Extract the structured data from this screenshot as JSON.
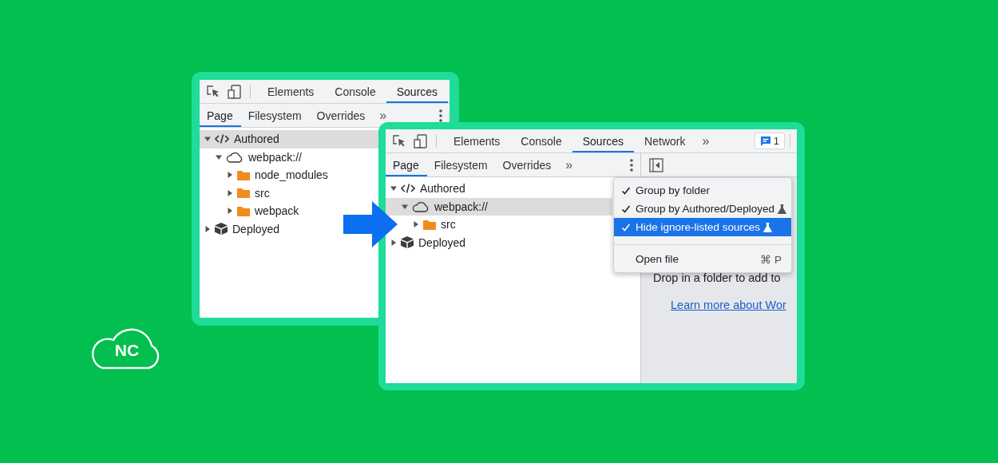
{
  "windows": [
    {
      "tabs": [
        {
          "label": "Elements",
          "selected": false
        },
        {
          "label": "Console",
          "selected": false
        },
        {
          "label": "Sources",
          "selected": true
        }
      ],
      "subtabs": [
        {
          "label": "Page",
          "selected": true
        },
        {
          "label": "Filesystem",
          "selected": false
        },
        {
          "label": "Overrides",
          "selected": false
        }
      ],
      "subtabs_more": "»",
      "tree": [
        {
          "label": "Authored",
          "kind": "code",
          "expanded": true,
          "selected": true,
          "children": [
            {
              "label": "webpack://",
              "kind": "cloud",
              "expanded": true,
              "selected": false,
              "children": [
                {
                  "label": "node_modules",
                  "kind": "folder",
                  "expanded": false,
                  "selected": false
                },
                {
                  "label": "src",
                  "kind": "folder",
                  "expanded": false,
                  "selected": false
                },
                {
                  "label": "webpack",
                  "kind": "folder",
                  "expanded": false,
                  "selected": false
                }
              ]
            }
          ]
        },
        {
          "label": "Deployed",
          "kind": "box",
          "expanded": false,
          "selected": false
        }
      ]
    },
    {
      "tabs": [
        {
          "label": "Elements",
          "selected": false
        },
        {
          "label": "Console",
          "selected": false
        },
        {
          "label": "Sources",
          "selected": true
        },
        {
          "label": "Network",
          "selected": false
        }
      ],
      "tabs_more": "»",
      "issues_badge": "1",
      "subtabs": [
        {
          "label": "Page",
          "selected": true
        },
        {
          "label": "Filesystem",
          "selected": false
        },
        {
          "label": "Overrides",
          "selected": false
        }
      ],
      "subtabs_more": "»",
      "tree": [
        {
          "label": "Authored",
          "kind": "code",
          "expanded": true,
          "selected": false,
          "children": [
            {
              "label": "webpack://",
              "kind": "cloud",
              "expanded": true,
              "selected": true,
              "children": [
                {
                  "label": "src",
                  "kind": "folder",
                  "expanded": false,
                  "selected": false
                }
              ]
            }
          ]
        },
        {
          "label": "Deployed",
          "kind": "box",
          "expanded": false,
          "selected": false
        }
      ],
      "side_panel": {
        "drop_text": "Drop in a folder to add to",
        "link": "Learn more about Wor"
      },
      "menu": {
        "sections": [
          {
            "items": [
              {
                "label": "Group by folder",
                "checked": true,
                "selected": false,
                "experimental": false
              },
              {
                "label": "Group by Authored/Deployed",
                "checked": true,
                "selected": false,
                "experimental": true
              },
              {
                "label": "Hide ignore-listed sources",
                "checked": true,
                "selected": true,
                "experimental": true
              }
            ]
          },
          {
            "items": [
              {
                "label": "Open file",
                "checked": false,
                "selected": false,
                "experimental": false,
                "shortcut": "⌘ P"
              }
            ]
          }
        ]
      }
    }
  ],
  "logo": {
    "text": "NC"
  }
}
